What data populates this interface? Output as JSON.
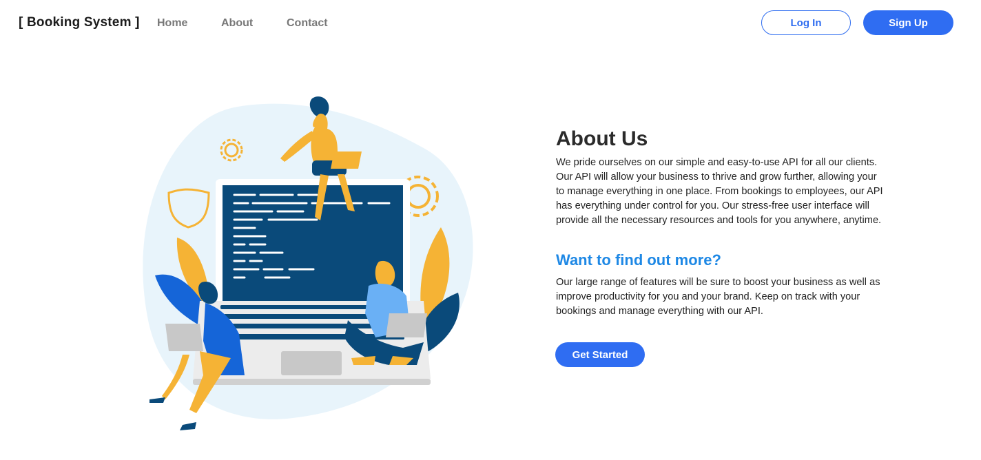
{
  "nav": {
    "brand": "[ Booking System ]",
    "links": [
      "Home",
      "About",
      "Contact"
    ],
    "login_label": "Log In",
    "signup_label": "Sign Up"
  },
  "about": {
    "title": "About Us",
    "paragraph": "We pride ourselves on our simple and easy-to-use API for all our clients. Our API will allow your business to thrive and grow further, allowing your to manage everything in one place. From bookings to employees, our API has everything under control for you. Our stress-free user interface will provide all the necessary resources and tools for you anywhere, anytime.",
    "subtitle": "Want to find out more?",
    "paragraph2": "Our large range of features will be sure to boost your business as well as improve productivity for you and your brand. Keep on track with your bookings and manage everything with our API.",
    "cta_label": "Get Started"
  },
  "colors": {
    "accent": "#2f6df2",
    "subtitle": "#1e88e5",
    "illustration_navy": "#0a4a7a",
    "illustration_yellow": "#f5b335",
    "illustration_blob": "#e8f4fb"
  },
  "icons": [
    "gear-icon",
    "shield-icon",
    "laptop-illustration"
  ]
}
